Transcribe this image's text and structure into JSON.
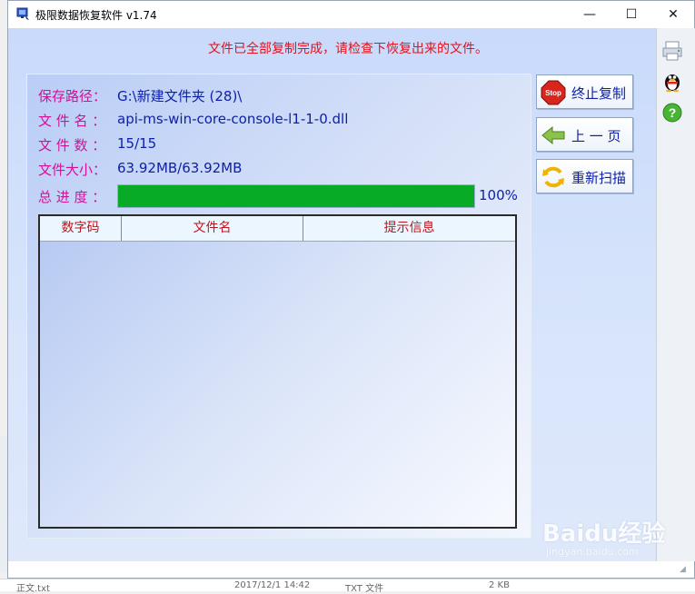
{
  "window": {
    "title": "极限数据恢复软件 v1.74",
    "minimize_glyph": "—",
    "maximize_glyph": "☐",
    "close_glyph": "✕"
  },
  "status_message": "文件已全部复制完成，请检查下恢复出来的文件。",
  "info": {
    "path_label": "保存路径：",
    "path_value": "G:\\新建文件夹 (28)\\",
    "filename_label": "文 件 名 ：",
    "filename_value": "api-ms-win-core-console-l1-1-0.dll",
    "count_label": "文 件 数 ：",
    "count_value": "15/15",
    "size_label": "文件大小：",
    "size_value": "63.92MB/63.92MB",
    "progress_label": "总 进 度 ：",
    "progress_percent_text": "100%",
    "progress_fraction": 1.0
  },
  "table": {
    "columns": [
      "数字码",
      "文件名",
      "提示信息"
    ],
    "rows": []
  },
  "buttons": {
    "stop_label": "终止复制",
    "back_label": "上 一 页",
    "rescan_label": "重新扫描"
  },
  "icons": {
    "stop": "stop-sign-icon",
    "back": "left-arrow-icon",
    "rescan": "refresh-icon",
    "strip": [
      "printer-icon",
      "qq-penguin-icon",
      "help-icon"
    ]
  },
  "colors": {
    "status_text": "#e8101a",
    "label_text": "#d2109a",
    "value_text": "#0c1fa6",
    "progress_fill": "#08ab25",
    "header_text": "#c0141b"
  },
  "background": {
    "bottom_row_name": "正文.txt",
    "bottom_row_date": "2017/12/1 14:42",
    "bottom_row_type": "TXT 文件",
    "bottom_row_size": "2 KB"
  },
  "watermark": {
    "main": "Baidu经验",
    "sub": "jingyan.baidu.com"
  }
}
